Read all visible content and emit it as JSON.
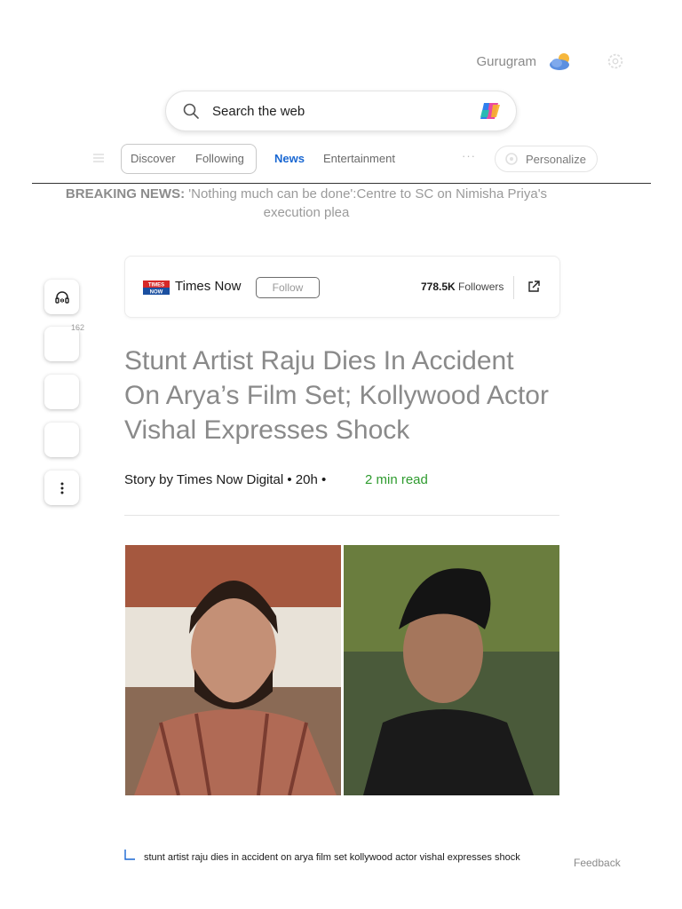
{
  "header": {
    "location": "Gurugram",
    "weather_icon": "partly-cloudy-icon",
    "settings_icon": "gear-icon"
  },
  "search": {
    "placeholder": "Search the web",
    "copilot_icon": "copilot-icon"
  },
  "nav": {
    "tabs": [
      {
        "label": "Discover"
      },
      {
        "label": "Following"
      },
      {
        "label": "News",
        "active": true
      },
      {
        "label": "Entertainment"
      }
    ],
    "more": "···",
    "personalize_label": "Personalize"
  },
  "breaking": {
    "tag": "BREAKING NEWS:",
    "text": "'Nothing much can be done':Centre to SC on Nimisha Priya's execution plea"
  },
  "sidebar": {
    "comment_count": "162"
  },
  "source": {
    "logo_text": "TIMES NOW",
    "name": "Times Now",
    "follow_label": "Follow",
    "followers_count": "778.5K",
    "followers_label": "Followers"
  },
  "article": {
    "title": "Stunt Artist Raju Dies In Accident On Arya’s Film Set; Kollywood Actor Vishal Expresses Shock",
    "byline": "Story by Times Now Digital • 20h •",
    "read_time": "2 min read",
    "caption": "stunt artist raju dies in accident on arya film set kollywood actor vishal expresses shock"
  },
  "footer": {
    "feedback_label": "Feedback"
  },
  "colors": {
    "accent": "#1967d2",
    "read_time": "#2e9b2e"
  }
}
